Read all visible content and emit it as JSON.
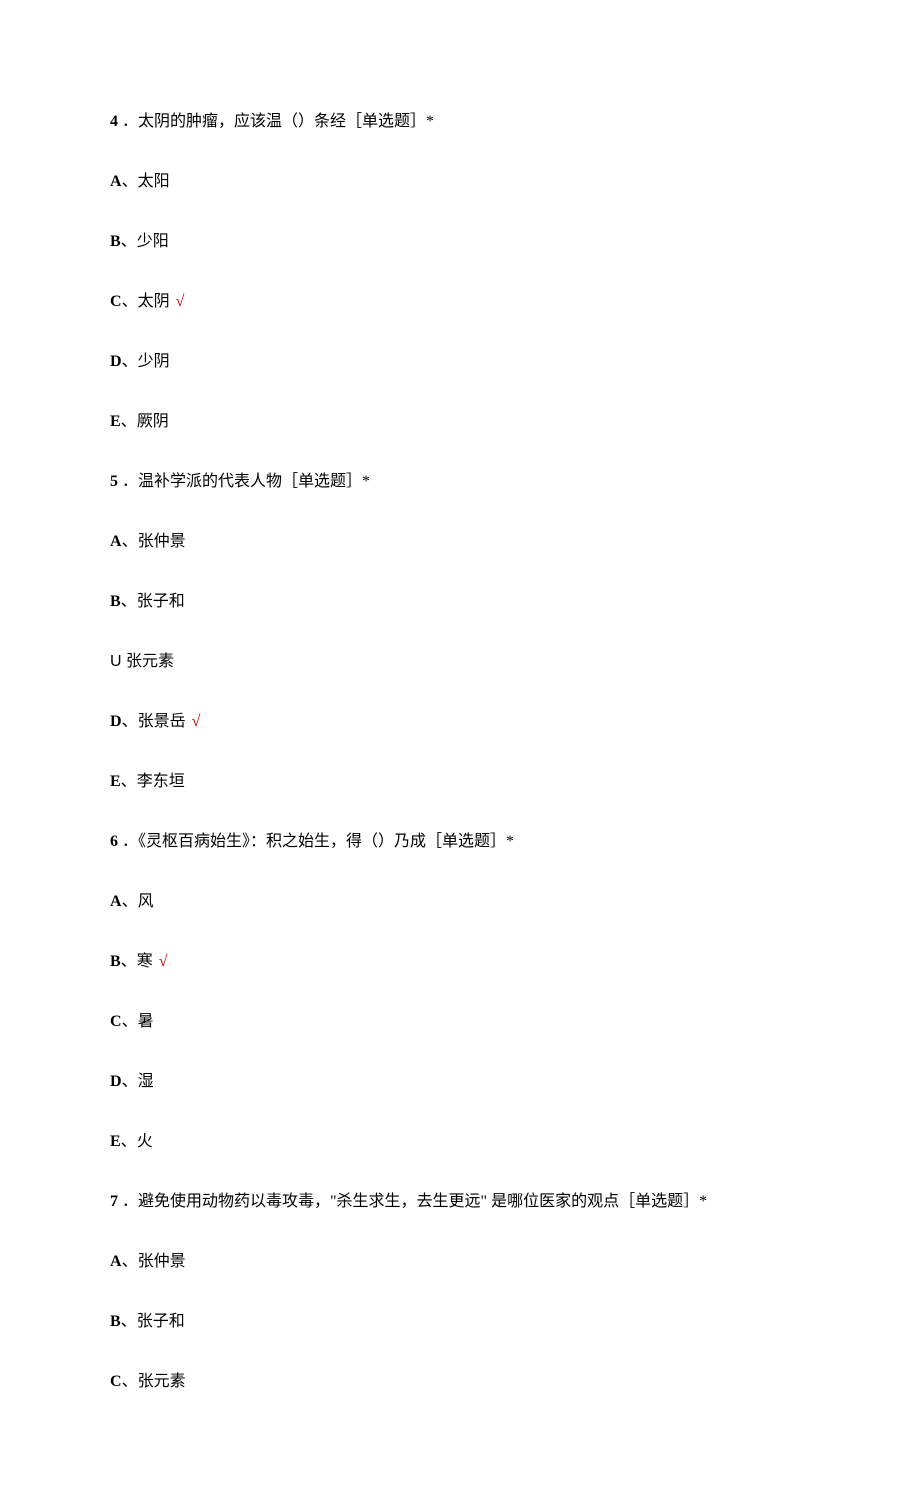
{
  "questions": [
    {
      "num": "4",
      "stem": "．太阴的肿瘤，应该温（）条经［单选题］*",
      "options": [
        {
          "letter": "A",
          "sep": "、",
          "text": "太阳",
          "correct": false
        },
        {
          "letter": "B",
          "sep": "、",
          "text": "少阳",
          "correct": false
        },
        {
          "letter": "C",
          "sep": "、",
          "text": "太阴",
          "correct": true
        },
        {
          "letter": "D",
          "sep": "、",
          "text": "少阴",
          "correct": false
        },
        {
          "letter": "E",
          "sep": "、",
          "text": "厥阴",
          "correct": false
        }
      ]
    },
    {
      "num": "5",
      "stem": "．温补学派的代表人物［单选题］*",
      "options": [
        {
          "letter": "A",
          "sep": "、",
          "text": "张仲景",
          "correct": false
        },
        {
          "letter": "B",
          "sep": "、",
          "text": "张子和",
          "correct": false
        },
        {
          "misprint": "U 张元素"
        },
        {
          "letter": "D",
          "sep": "、",
          "text": "张景岳",
          "correct": true
        },
        {
          "letter": "E",
          "sep": "、",
          "text": "李东垣",
          "correct": false
        }
      ]
    },
    {
      "num": "6",
      "stem": "．《灵枢百病始生》：积之始生，得（）乃成［单选题］*",
      "options": [
        {
          "letter": "A",
          "sep": "、",
          "text": "风",
          "correct": false
        },
        {
          "letter": "B",
          "sep": "、",
          "text": "寒",
          "correct": true
        },
        {
          "letter": "C",
          "sep": "、",
          "text": "暑",
          "correct": false
        },
        {
          "letter": "D",
          "sep": "、",
          "text": "湿",
          "correct": false
        },
        {
          "letter": "E",
          "sep": "、",
          "text": "火",
          "correct": false
        }
      ]
    },
    {
      "num": "7",
      "stem": "．避免使用动物药以毒攻毒，\"杀生求生，去生更远\" 是哪位医家的观点［单选题］*",
      "options": [
        {
          "letter": "A",
          "sep": "、",
          "text": "张仲景",
          "correct": false
        },
        {
          "letter": "B",
          "sep": "、",
          "text": "张子和",
          "correct": false
        },
        {
          "letter": "C",
          "sep": "、",
          "text": "张元素",
          "correct": false
        }
      ]
    }
  ],
  "check_mark": "√"
}
